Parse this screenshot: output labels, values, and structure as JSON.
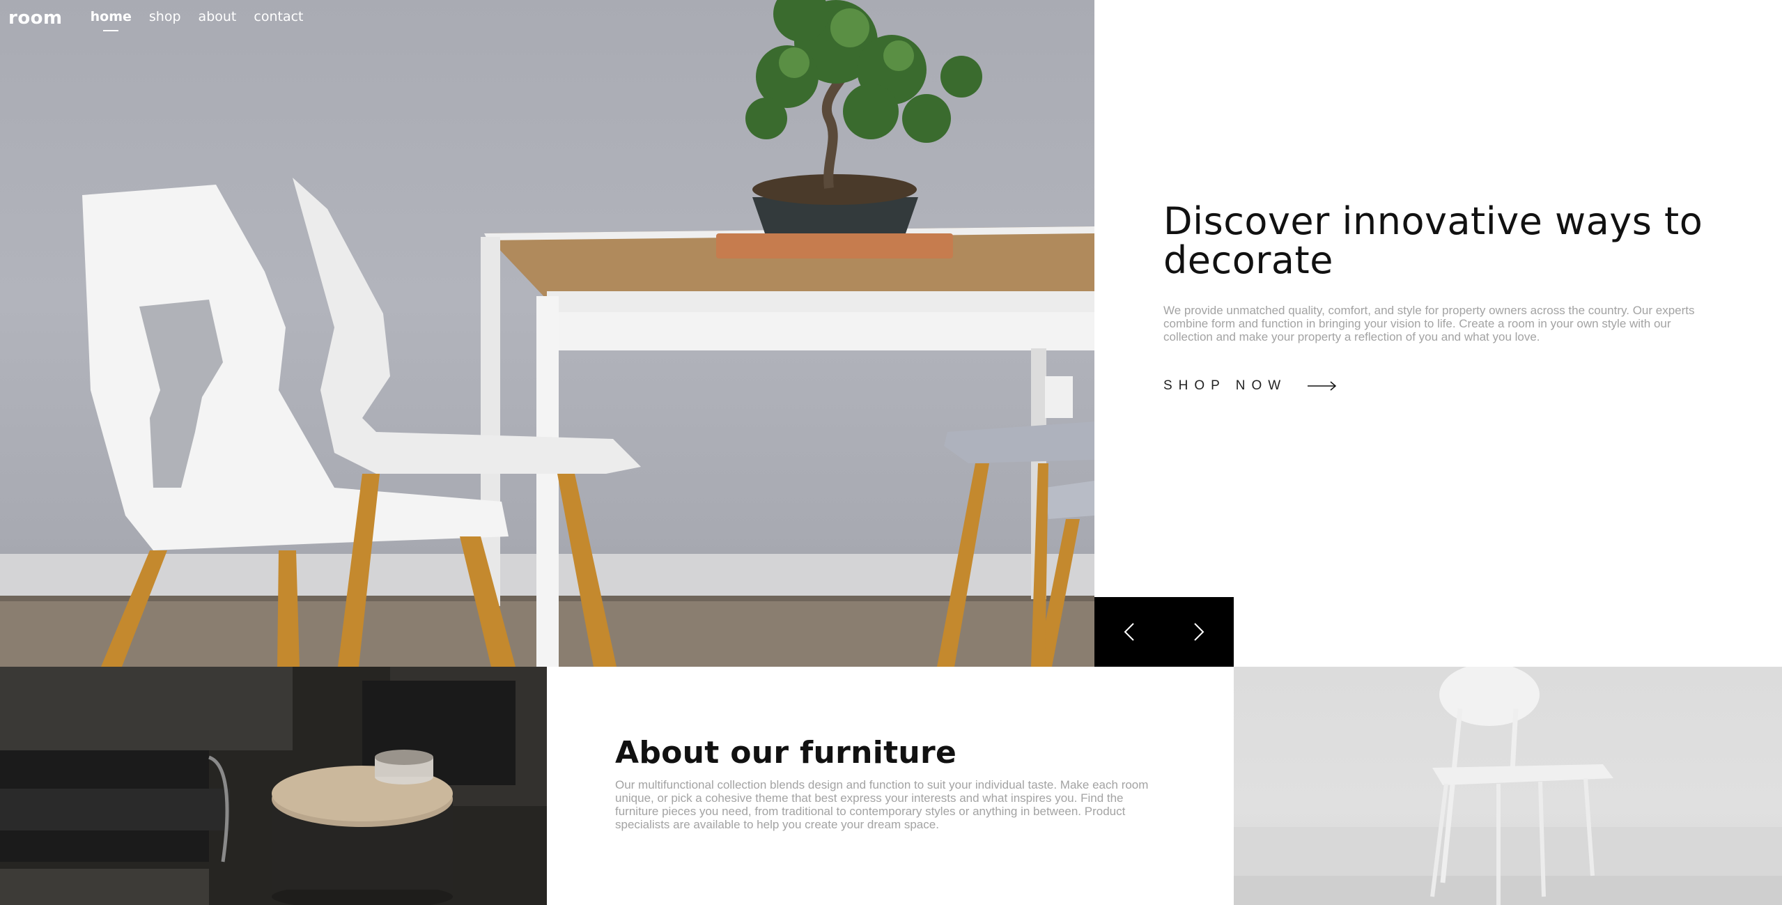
{
  "brand": {
    "logo": "room"
  },
  "nav": {
    "items": [
      {
        "label": "home",
        "active": true
      },
      {
        "label": "shop",
        "active": false
      },
      {
        "label": "about",
        "active": false
      },
      {
        "label": "contact",
        "active": false
      }
    ]
  },
  "hero": {
    "title": "Discover innovative ways to decorate",
    "description": "We provide unmatched quality, comfort, and style for property owners across the country. Our experts combine form and function in bringing your vision to life. Create a room in your own style with our collection and make your property a reflection of you and what you love.",
    "cta_label": "SHOP NOW",
    "cta_icon": "arrow-right-icon",
    "image": "white-chairs-table-bonsai-photo"
  },
  "slider": {
    "prev_icon": "chevron-left-icon",
    "next_icon": "chevron-right-icon"
  },
  "about": {
    "title": "About our furniture",
    "description": "Our multifunctional collection blends design and function to suit your individual taste. Make each room unique, or pick a cohesive theme that best express your interests and what inspires you. Find the furniture pieces you need, from traditional to contemporary styles or anything in between. Product specialists are available to help you create your dream space.",
    "image_left": "dark-armchair-coffee-table-photo",
    "image_right": "white-chair-photo"
  },
  "colors": {
    "text_dark": "#111111",
    "text_muted": "#a3a3a3",
    "slider_bg": "#000000",
    "background": "#ffffff"
  }
}
